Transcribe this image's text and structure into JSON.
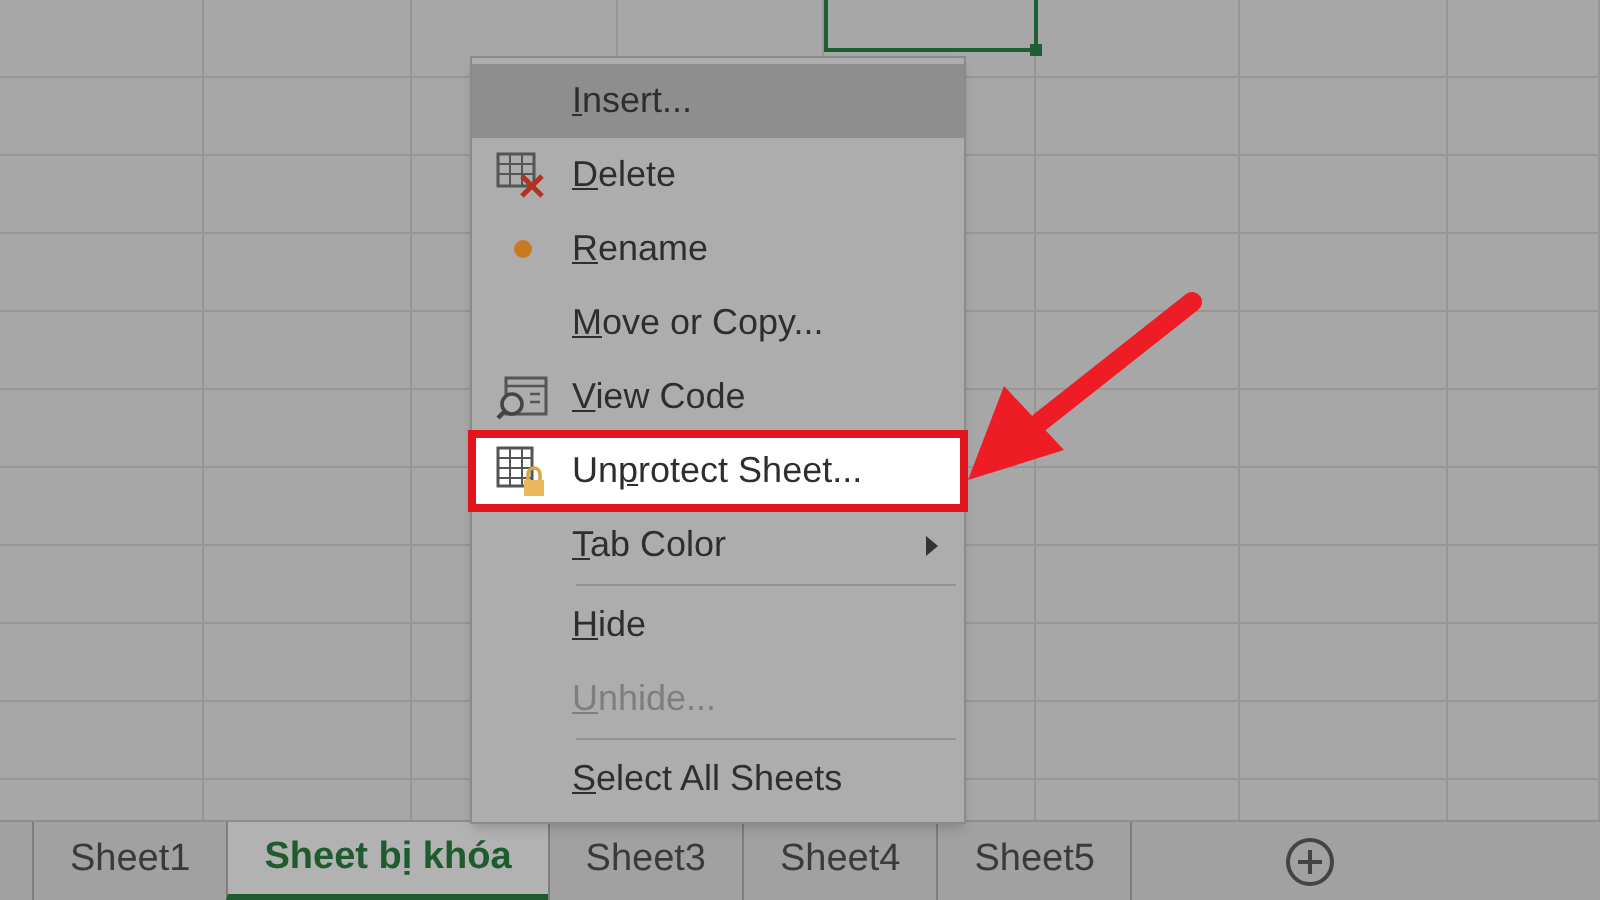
{
  "context_menu": {
    "items": [
      {
        "kind": "item",
        "label": {
          "key": "I",
          "after": "nsert..."
        },
        "selected": true,
        "disabled": false,
        "annotated": false,
        "submenu": false
      },
      {
        "kind": "item",
        "label": {
          "key": "D",
          "after": "elete"
        },
        "selected": false,
        "disabled": false,
        "annotated": false,
        "submenu": false
      },
      {
        "kind": "item",
        "label": {
          "key": "R",
          "after": "ename"
        },
        "selected": false,
        "disabled": false,
        "annotated": false,
        "submenu": false
      },
      {
        "kind": "item",
        "label": {
          "key": "M",
          "after": "ove or Copy..."
        },
        "selected": false,
        "disabled": false,
        "annotated": false,
        "submenu": false
      },
      {
        "kind": "item",
        "label": {
          "key": "V",
          "after": "iew Code"
        },
        "selected": false,
        "disabled": false,
        "annotated": false,
        "submenu": false
      },
      {
        "kind": "item",
        "label": {
          "before": "Un",
          "key": "p",
          "after": "rotect Sheet..."
        },
        "selected": false,
        "disabled": false,
        "annotated": true,
        "submenu": false
      },
      {
        "kind": "item",
        "label": {
          "key": "T",
          "after": "ab Color"
        },
        "selected": false,
        "disabled": false,
        "annotated": false,
        "submenu": true
      },
      {
        "kind": "separator"
      },
      {
        "kind": "item",
        "label": {
          "key": "H",
          "after": "ide"
        },
        "selected": false,
        "disabled": false,
        "annotated": false,
        "submenu": false
      },
      {
        "kind": "item",
        "label": {
          "key": "U",
          "after": "nhide..."
        },
        "selected": false,
        "disabled": true,
        "annotated": false,
        "submenu": false
      },
      {
        "kind": "separator"
      },
      {
        "kind": "item",
        "label": {
          "key": "S",
          "after": "elect All Sheets"
        },
        "selected": false,
        "disabled": false,
        "annotated": false,
        "submenu": false
      }
    ]
  },
  "sheet_tabs": [
    {
      "label": "Sheet1",
      "selected": false
    },
    {
      "label": "Sheet bị khóa",
      "selected": true
    },
    {
      "label": "Sheet3",
      "selected": false
    },
    {
      "label": "Sheet4",
      "selected": false
    },
    {
      "label": "Sheet5",
      "selected": false
    }
  ]
}
